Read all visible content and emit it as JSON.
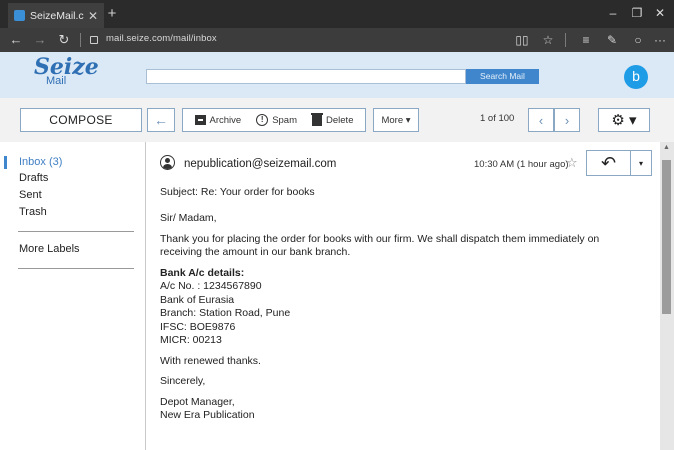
{
  "browser": {
    "tab_title": "SeizeMail.c",
    "url": "mail.seize.com/mail/inbox",
    "icons": {
      "new_tab": "+",
      "minimize": "–",
      "restore": "❐",
      "close": "✕",
      "back": "←",
      "forward": "→",
      "refresh": "↻",
      "reading_view": "📖",
      "favorite": "☆",
      "hub": "≡",
      "notes": "✎",
      "share": "○",
      "more": "···"
    }
  },
  "header": {
    "logo_main": "Seize",
    "logo_sub": "Mail",
    "search_placeholder": "",
    "search_button": "Search Mail",
    "avatar_letter": "b"
  },
  "toolbar": {
    "compose": "COMPOSE",
    "back": "←",
    "archive": "Archive",
    "spam": "Spam",
    "delete": "Delete",
    "more": "More ▾",
    "pager": "1 of 100",
    "prev": "‹",
    "next": "›",
    "settings": "⚙ ▾"
  },
  "sidebar": {
    "items": [
      {
        "label": "Inbox (3)",
        "active": true
      },
      {
        "label": "Drafts"
      },
      {
        "label": "Sent"
      },
      {
        "label": "Trash"
      }
    ],
    "more_labels": "More Labels"
  },
  "message": {
    "sender": "nepublication@seizemail.com",
    "time": "10:30 AM (1 hour ago)",
    "star": "☆",
    "reply": "↶",
    "reply_dropdown": "▾",
    "subject": "Subject:  Re:  Your order for books",
    "greeting": "Sir/ Madam,",
    "paragraph": "Thank you for placing the order for books with our firm. We shall dispatch them immediately on receiving the amount in our bank branch.",
    "bank_heading": "Bank A/c details:",
    "bank_lines": [
      "A/c No. : 1234567890",
      "Bank of Eurasia",
      "Branch: Station Road, Pune",
      "IFSC: BOE9876",
      "MICR: 00213"
    ],
    "thanks": "With renewed thanks.",
    "closing": "Sincerely,",
    "signature": [
      "Depot Manager,",
      "New Era Publication"
    ]
  },
  "colors": {
    "accent": "#3f86cc",
    "header_bg": "#dbe9f6",
    "chrome_dark": "#2b2b2b"
  }
}
